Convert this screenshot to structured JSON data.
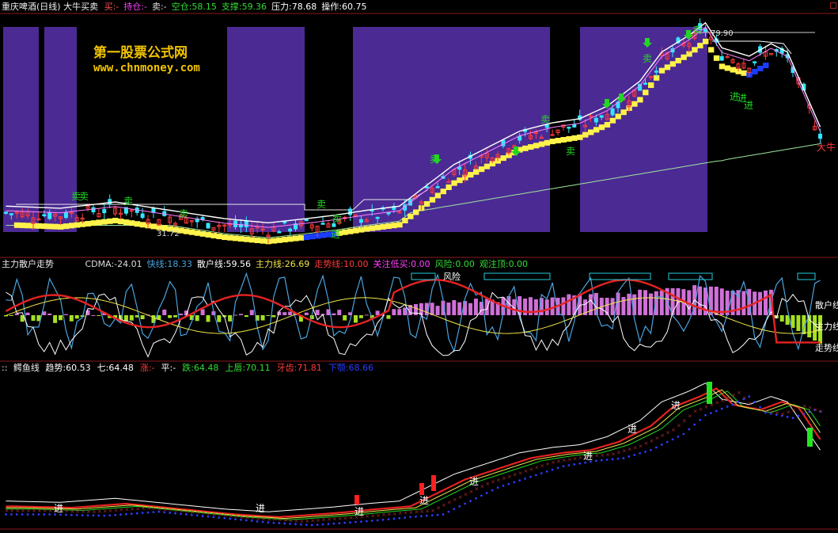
{
  "colors": {
    "bg": "#000000",
    "divider": "#8b1a1a",
    "purple_band": "#4b2a93",
    "yellow_steps": "#fff24a",
    "blue_steps": "#1a3cff",
    "up_candle": "#ff3b3b",
    "down_candle": "#33e6ff",
    "white_line": "#ffffff",
    "green_line": "#9fe69f",
    "pink_bar": "#d070d8",
    "lime_bar": "#a6e022",
    "sky_line": "#4aa3df",
    "red_line": "#e62222",
    "yellow_line": "#f2e64a",
    "green_signal": "#22d622",
    "navy_dots": "#2a3cff"
  },
  "header": {
    "title": "重庆啤酒(日线) 大牛买卖",
    "close_mark": "☐",
    "items": [
      {
        "label": "买:-",
        "color": "#ff5050"
      },
      {
        "label": "持仓:-",
        "color": "#ff40ff"
      },
      {
        "label": "卖:-",
        "color": "#dddddd"
      },
      {
        "label": "空仓:58.15",
        "color": "#33dd33"
      },
      {
        "label": "支撑:59.36",
        "color": "#33dd33"
      },
      {
        "label": "压力:78.68",
        "color": "#ffffff"
      },
      {
        "label": "操作:60.75",
        "color": "#ffffff"
      }
    ]
  },
  "watermark": {
    "line1": "第一股票公式网",
    "line2": "www.chnmoney.com"
  },
  "main_panel": {
    "price_high_label": "79.90",
    "price_low_label": "31.72",
    "signals": [
      {
        "text": "卖",
        "kind": "sell"
      },
      {
        "text": "卖",
        "kind": "sell"
      },
      {
        "text": "卖",
        "kind": "sell"
      },
      {
        "text": "卖",
        "kind": "sell"
      },
      {
        "text": "卖",
        "kind": "sell"
      },
      {
        "text": "卖",
        "kind": "sell"
      },
      {
        "text": "卖",
        "kind": "sell"
      },
      {
        "text": "卖",
        "kind": "sell"
      },
      {
        "text": "卖",
        "kind": "sell"
      },
      {
        "text": "卖",
        "kind": "sell"
      },
      {
        "text": "卖",
        "kind": "sell"
      },
      {
        "text": "进",
        "kind": "buy"
      },
      {
        "text": "进",
        "kind": "buy"
      },
      {
        "text": "进",
        "kind": "buy"
      },
      {
        "text": "进",
        "kind": "buy"
      },
      {
        "text": "大牛",
        "kind": "bull"
      }
    ]
  },
  "mid_panel": {
    "title": "主力散户走势",
    "items": [
      {
        "label": "CDMA:-24.01",
        "color": "#dddddd"
      },
      {
        "label": "快线:18.33",
        "color": "#4aa3df"
      },
      {
        "label": "散户线:59.56",
        "color": "#ffffff"
      },
      {
        "label": "主力线:26.69",
        "color": "#f2e64a"
      },
      {
        "label": "走势线:10.00",
        "color": "#ff3b3b"
      },
      {
        "label": "关注低买:0.00",
        "color": "#ff40ff"
      },
      {
        "label": "风险:0.00",
        "color": "#33dd33"
      },
      {
        "label": "观注顶:0.00",
        "color": "#33dd33"
      }
    ],
    "risk_label": "风险",
    "right_labels": [
      "散户线",
      "主力线",
      "走势线"
    ]
  },
  "bottom_panel": {
    "title": "鳄鱼线",
    "items": [
      {
        "label": "趋势:60.53",
        "color": "#ffffff"
      },
      {
        "label": "七:64.48",
        "color": "#ffffff"
      },
      {
        "label": "涨:-",
        "color": "#ff3b3b"
      },
      {
        "label": "平:-",
        "color": "#ffffff"
      },
      {
        "label": "跌:64.48",
        "color": "#33dd33"
      },
      {
        "label": "上唇:70.11",
        "color": "#33dd33"
      },
      {
        "label": "牙齿:71.81",
        "color": "#ff3b3b"
      },
      {
        "label": "下颚:68.66",
        "color": "#2a3cff"
      }
    ],
    "signal_text": "进"
  }
}
